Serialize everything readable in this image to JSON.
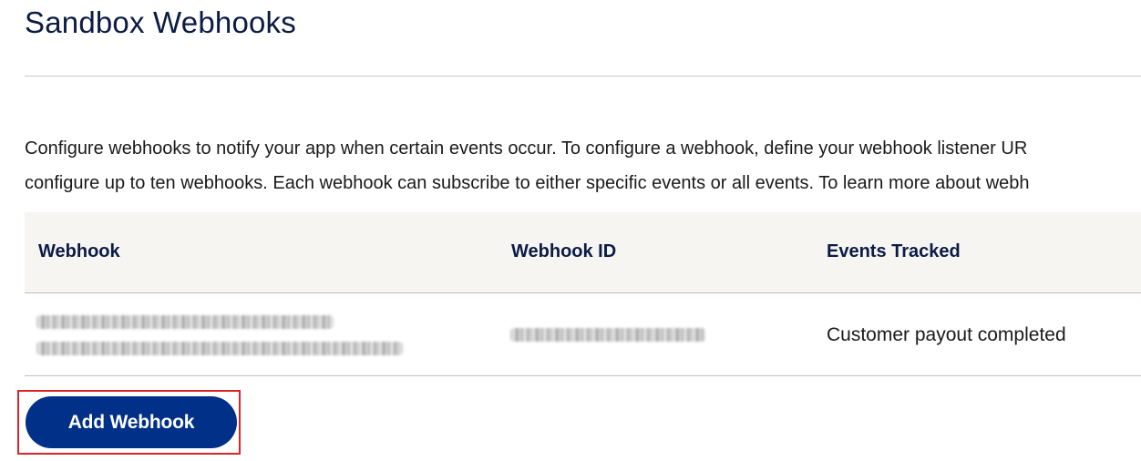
{
  "page": {
    "title": "Sandbox Webhooks",
    "description_lines": [
      "Configure webhooks to notify your app when certain events occur. To configure a webhook, define your webhook listener UR",
      "configure up to ten webhooks. Each webhook can subscribe to either specific events or all events. To learn more about webh"
    ]
  },
  "table": {
    "columns": [
      "Webhook",
      "Webhook ID",
      "Events Tracked"
    ],
    "rows": [
      {
        "webhook": "",
        "webhook_id": "",
        "events_tracked": "Customer payout completed"
      }
    ]
  },
  "actions": {
    "add_webhook_label": "Add Webhook"
  },
  "colors": {
    "title": "#0b1b44",
    "button_bg": "#003087",
    "button_text": "#ffffff",
    "header_bg": "#f7f5f2",
    "highlight": "#d9252a"
  }
}
